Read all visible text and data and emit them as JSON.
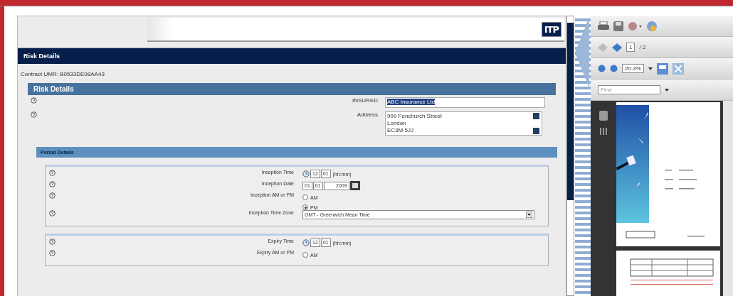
{
  "header": {
    "logo": "ITP"
  },
  "title_bar": "Risk Details",
  "contract_umr": "Contract UMR: B0533DE08AA43",
  "risk_section": {
    "title": "Risk Details",
    "fields": [
      {
        "kind": "text",
        "label": "INSURED",
        "value": "ABC Insurance Ltd",
        "highlighted": true
      },
      {
        "kind": "textarea",
        "label": "Address",
        "lines": [
          "999 Fenchurch Street",
          "London",
          "EC3M 5JJ"
        ]
      }
    ]
  },
  "period_section": {
    "title": "Period Details",
    "groups": [
      {
        "rows": [
          {
            "kind": "time",
            "label": "Inception Time",
            "hour": "12",
            "minute": "01",
            "format": "(hh:mm)"
          },
          {
            "kind": "date",
            "label": "Inception Date",
            "day": "01",
            "month": "01",
            "year": "2009"
          },
          {
            "kind": "radio",
            "label": "Inception AM or PM",
            "options": [
              {
                "label": "AM",
                "selected": false
              },
              {
                "label": "PM",
                "selected": true
              }
            ]
          },
          {
            "kind": "select",
            "label": "Inception Time Zone",
            "value": "GMT - Greenwich Mean Time"
          }
        ]
      },
      {
        "rows": [
          {
            "kind": "time",
            "label": "Expiry Time",
            "hour": "12",
            "minute": "01",
            "format": "(hh:mm)"
          },
          {
            "kind": "radio",
            "label": "Expiry AM or PM",
            "options": [
              {
                "label": "AM",
                "selected": false
              }
            ]
          }
        ]
      }
    ]
  },
  "pdf_viewer": {
    "page_field": "1",
    "page_count": "/ 2",
    "zoom": "20.3%",
    "find_placeholder": "Find"
  }
}
